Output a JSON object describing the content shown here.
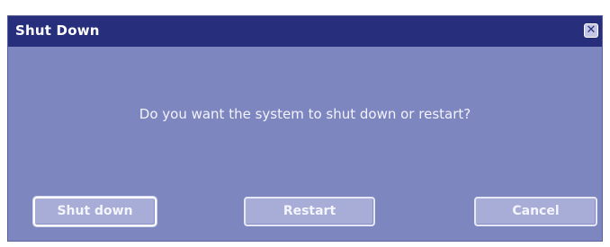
{
  "dialog": {
    "title": "Shut Down",
    "close_glyph": "✕",
    "message": "Do you want the system to shut down or restart?",
    "buttons": {
      "shutdown": "Shut down",
      "restart": "Restart",
      "cancel": "Cancel"
    }
  },
  "colors": {
    "titlebar": "#272f7d",
    "body": "#7e86c0",
    "button": "#a8add7"
  },
  "icons": {
    "close": "close-icon"
  }
}
